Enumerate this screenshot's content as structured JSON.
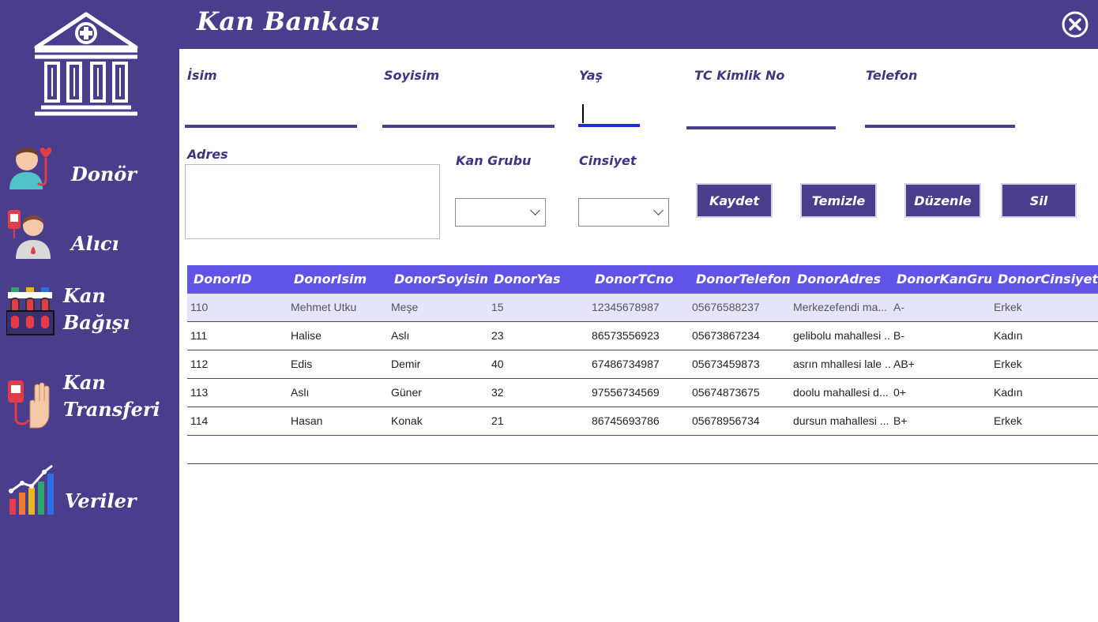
{
  "app": {
    "title": "Kan Bankası"
  },
  "nav": [
    {
      "label": "Donör"
    },
    {
      "label": "Alıcı"
    },
    {
      "label": "Kan",
      "label2": "Bağışı"
    },
    {
      "label": "Kan",
      "label2": "Transferi"
    },
    {
      "label": "Veriler"
    }
  ],
  "form": {
    "name_label": "İsim",
    "surname_label": "Soyisim",
    "age_label": "Yaş",
    "tc_label": "TC Kimlik No",
    "phone_label": "Telefon",
    "address_label": "Adres",
    "blood_group_label": "Kan Grubu",
    "gender_label": "Cinsiyet",
    "name_value": "",
    "surname_value": "",
    "age_value": "",
    "tc_value": "",
    "phone_value": "",
    "address_value": "",
    "blood_group_value": "",
    "gender_value": ""
  },
  "buttons": {
    "save": "Kaydet",
    "clear": "Temizle",
    "edit": "Düzenle",
    "delete": "Sil"
  },
  "table": {
    "columns": [
      "DonorID",
      "DonorIsim",
      "DonorSoyisim",
      "DonorYas",
      "DonorTCno",
      "DonorTelefon",
      "DonorAdres",
      "DonorKanGrubu",
      "DonorCinsiyet"
    ],
    "rows": [
      [
        "110",
        "Mehmet Utku",
        "Meşe",
        "15",
        "12345678987",
        "05676588237",
        "Merkezefendi ma...",
        "A-",
        "Erkek"
      ],
      [
        "111",
        "Halise",
        "Aslı",
        "23",
        "86573556923",
        "05673867234",
        "gelibolu mahallesi ...",
        "B-",
        "Kadın"
      ],
      [
        "112",
        "Edis",
        "Demir",
        "40",
        "67486734987",
        "05673459873",
        "asrın mhallesi lale ...",
        "AB+",
        "Erkek"
      ],
      [
        "113",
        "Aslı",
        "Güner",
        "32",
        "97556734569",
        "05674873675",
        "doolu mahallesi d...",
        "0+",
        "Kadın"
      ],
      [
        "114",
        "Hasan",
        "Konak",
        "21",
        "86745693786",
        "05678956734",
        "dursun mahallesi ...",
        "B+",
        "Erkek"
      ]
    ]
  },
  "colors": {
    "primary": "#4a3d8c",
    "header": "#6153e8",
    "selected_row": "#e6e4fa",
    "focus": "#1b2fd6"
  },
  "icons": [
    "hospital-logo-icon",
    "donor-icon",
    "recipient-icon",
    "blood-tubes-icon",
    "blood-transfer-icon",
    "chart-icon",
    "close-icon"
  ]
}
